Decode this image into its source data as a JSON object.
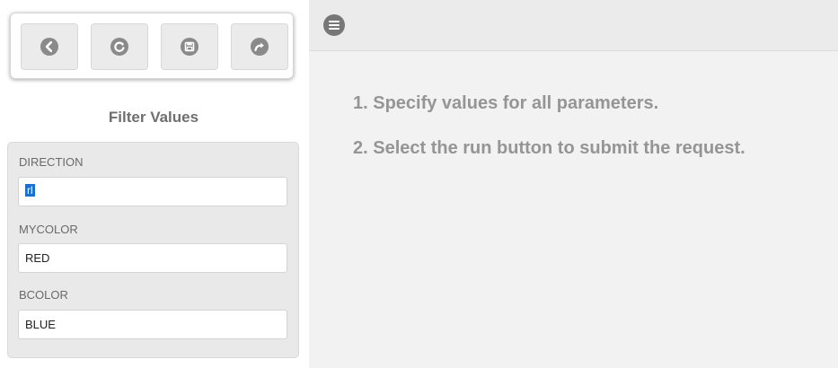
{
  "toolbar": {
    "buttons": [
      {
        "icon": "back-icon"
      },
      {
        "icon": "refresh-icon"
      },
      {
        "icon": "save-icon"
      },
      {
        "icon": "share-icon"
      }
    ]
  },
  "filter": {
    "title": "Filter Values",
    "fields": [
      {
        "label": "DIRECTION",
        "value": "rl"
      },
      {
        "label": "MYCOLOR",
        "value": "RED"
      },
      {
        "label": "BCOLOR",
        "value": "BLUE"
      }
    ]
  },
  "main": {
    "menu_icon": "menu-icon",
    "instructions": [
      "1. Specify values for all parameters.",
      "2. Select the run button to submit the request."
    ]
  },
  "colors": {
    "panel_bg": "#e9e9e9",
    "icon_gray": "#8a8a8a",
    "instruction_text": "#959595",
    "selection": "#1a6fd0"
  }
}
